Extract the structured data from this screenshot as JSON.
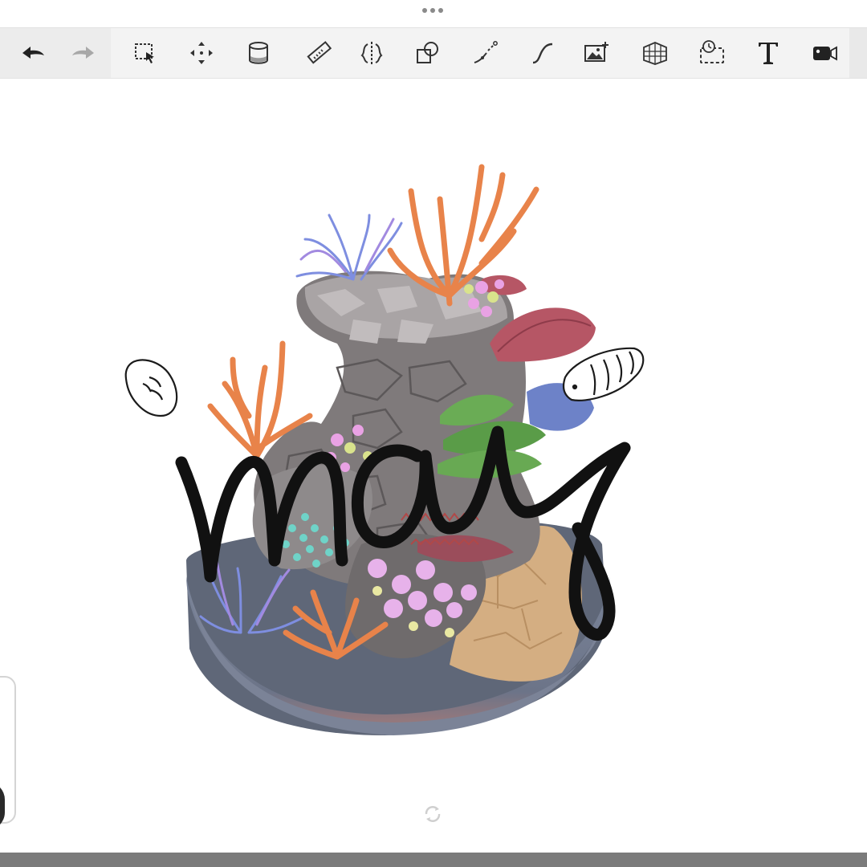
{
  "app": {
    "grab_handle_icon": "more-dots-icon"
  },
  "toolbar": {
    "tools": [
      {
        "id": "undo",
        "icon": "undo-icon"
      },
      {
        "id": "redo",
        "icon": "redo-icon",
        "enabled": false
      },
      {
        "id": "selection",
        "icon": "selection-icon"
      },
      {
        "id": "transform",
        "icon": "move-icon"
      },
      {
        "id": "fill",
        "icon": "fill-bucket-icon"
      },
      {
        "id": "ruler",
        "icon": "ruler-icon"
      },
      {
        "id": "symmetry",
        "icon": "symmetry-icon"
      },
      {
        "id": "shapes",
        "icon": "shapes-icon"
      },
      {
        "id": "predictive-stroke",
        "icon": "stroke-icon"
      },
      {
        "id": "curve",
        "icon": "curve-icon"
      },
      {
        "id": "import-image",
        "icon": "image-add-icon"
      },
      {
        "id": "perspective",
        "icon": "perspective-grid-icon"
      },
      {
        "id": "time-lapse",
        "icon": "timelapse-icon"
      },
      {
        "id": "text",
        "icon": "text-icon",
        "glyph": "T"
      },
      {
        "id": "record",
        "icon": "video-camera-icon"
      }
    ]
  },
  "canvas": {
    "artwork": "coral-reef-bowl-illustration",
    "handwritten_text": "may",
    "colors": {
      "pot": "#717b8f",
      "pot_rim": "#5f6778",
      "rock": "#8a8585",
      "rock_dark": "#6e6a6b",
      "coral_orange": "#e8834a",
      "coral_blue": "#7e8ee0",
      "coral_pink": "#e9a2e4",
      "coral_green": "#6aac55",
      "coral_red": "#b65665",
      "sand": "#d4ae82",
      "ink": "#111111"
    }
  },
  "status": {
    "sync_icon": "sync-icon"
  }
}
